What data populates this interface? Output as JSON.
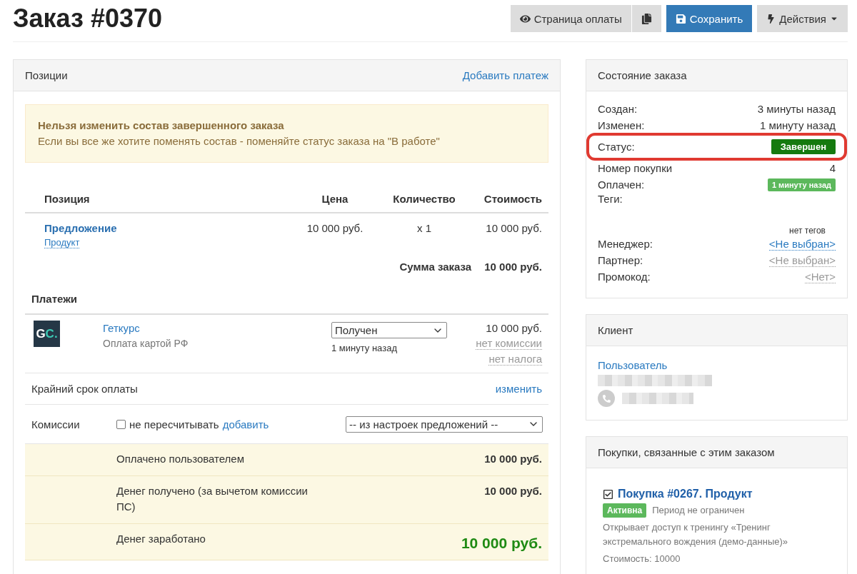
{
  "title": "Заказ #0370",
  "header_buttons": [
    {
      "kind": "eye",
      "label": "Страница оплаты"
    },
    {
      "kind": "copy"
    },
    {
      "kind": "save",
      "label": "Сохранить"
    },
    {
      "kind": "actions",
      "label": "Действия"
    }
  ],
  "items_panel": {
    "title": "Позиции",
    "action_link": "Добавить платеж",
    "alert": {
      "title": "Нельзя изменить состав завершенного заказа",
      "text": "Если вы все же хотите поменять состав - поменяйте статус заказа на \"В работе\""
    },
    "columns": [
      "Позиция",
      "Цена",
      "Количество",
      "Стоимость"
    ],
    "rows": [
      {
        "name": "Предложение",
        "type_link": "Продукт",
        "price": "10 000 руб.",
        "qty": "x 1",
        "cost": "10 000 руб."
      }
    ],
    "total": {
      "label": "Сумма заказа",
      "value": "10 000 руб."
    },
    "payments_title": "Платежи",
    "payments": [
      {
        "logo": "GC.",
        "name": "Геткурс",
        "method": "Оплата картой РФ",
        "status": "Получен",
        "status_time": "1 минуту назад",
        "amount": "10 000 руб.",
        "commission": "нет комиссии",
        "tax": "нет налога"
      }
    ],
    "deadline": {
      "label": "Крайний срок оплаты",
      "action": "изменить"
    },
    "commissions": {
      "label": "Комиссии",
      "checkbox_label": "не пересчитывать",
      "checked": false,
      "add_link": "добавить",
      "select": "-- из настроек предложений --"
    },
    "summary": [
      {
        "kind": "normal",
        "label": "Оплачено пользователем",
        "value": "10 000 руб."
      },
      {
        "kind": "normal",
        "label": "Денег получено (за вычетом комиссии ПС)",
        "value": "10 000 руб."
      },
      {
        "kind": "highlight",
        "label": "Денег заработано",
        "value": "10 000 руб."
      }
    ]
  },
  "order_state": {
    "title": "Состояние заказа",
    "rows": [
      {
        "kind": "text",
        "label": "Создан:",
        "value": "3 минуты назад",
        "highlighted": false
      },
      {
        "kind": "text",
        "label": "Изменен:",
        "value": "1 минуту назад",
        "highlighted": false
      },
      {
        "kind": "badge",
        "label": "Статус:",
        "value": "Завершен",
        "color": "#157a0f",
        "highlighted": true
      },
      {
        "kind": "text",
        "label": "Номер покупки",
        "value": "4",
        "highlighted": false
      },
      {
        "kind": "badge",
        "label": "Оплачен:",
        "value": "1 минуту назад",
        "color": "#5cb85c",
        "highlighted": false
      },
      {
        "kind": "tags",
        "label": "Теги:",
        "value": "нет тегов",
        "highlighted": false
      },
      {
        "kind": "link",
        "label": "Менеджер:",
        "value": "<Не выбран>",
        "highlighted": false
      },
      {
        "kind": "muted_link",
        "label": "Партнер:",
        "value": "<Не выбран>",
        "highlighted": false
      },
      {
        "kind": "muted_link",
        "label": "Промокод:",
        "value": "<Нет>",
        "highlighted": false
      }
    ]
  },
  "client": {
    "title": "Клиент",
    "name_link": "Пользователь"
  },
  "purchases": {
    "title": "Покупки, связанные с этим заказом",
    "items": [
      {
        "title": "Покупка #0267. Продукт",
        "status": "Активна",
        "period": "Период не ограничен",
        "description": "Открывает доступ к тренингу «Тренинг экстремального вождения (демо-данные)»",
        "cost": "Стоимость: 10000"
      }
    ]
  }
}
